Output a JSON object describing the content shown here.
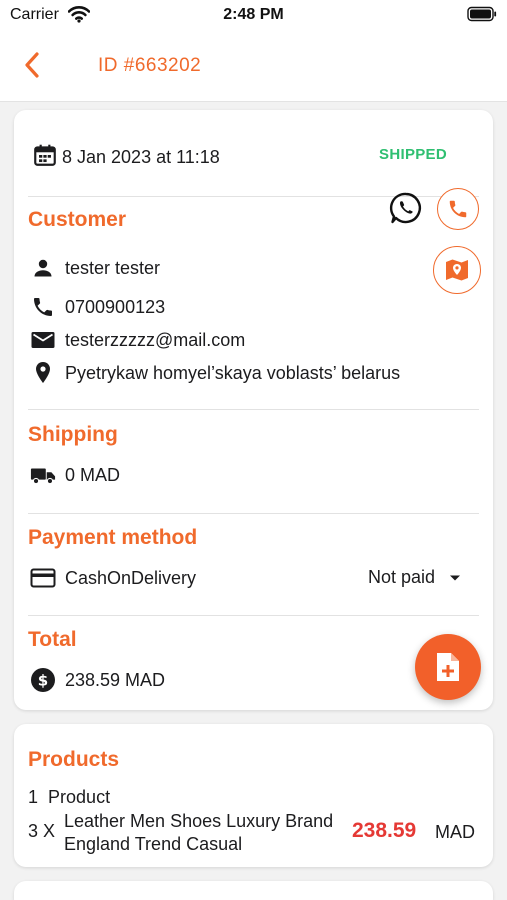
{
  "status_bar": {
    "carrier": "Carrier",
    "time": "2:48 PM"
  },
  "header": {
    "title": "ID #663202",
    "back_icon": "chevron-left-icon"
  },
  "order": {
    "date": "8 Jan 2023 at 11:18",
    "status": "SHIPPED"
  },
  "customer": {
    "title": "Customer",
    "name": "tester tester",
    "phone": "0700900123",
    "email": "testerzzzzz@mail.com",
    "address": "Pyetrykaw homyel’skaya voblasts’ belarus"
  },
  "shipping": {
    "title": "Shipping",
    "amount": "0 MAD"
  },
  "payment": {
    "title": "Payment method",
    "method": "CashOnDelivery",
    "status": "Not paid"
  },
  "total": {
    "title": "Total",
    "amount": "238.59 MAD"
  },
  "products": {
    "title": "Products",
    "count_number": "1",
    "count_label": "Product",
    "items": [
      {
        "qty": "3 X",
        "name": "Leather Men Shoes Luxury Brand England Trend Casual",
        "price": "238.59",
        "currency": "MAD"
      }
    ]
  },
  "colors": {
    "accent": "#f06a2c",
    "shipped": "#2fbf71",
    "price": "#e53935",
    "fab": "#f2602a"
  }
}
